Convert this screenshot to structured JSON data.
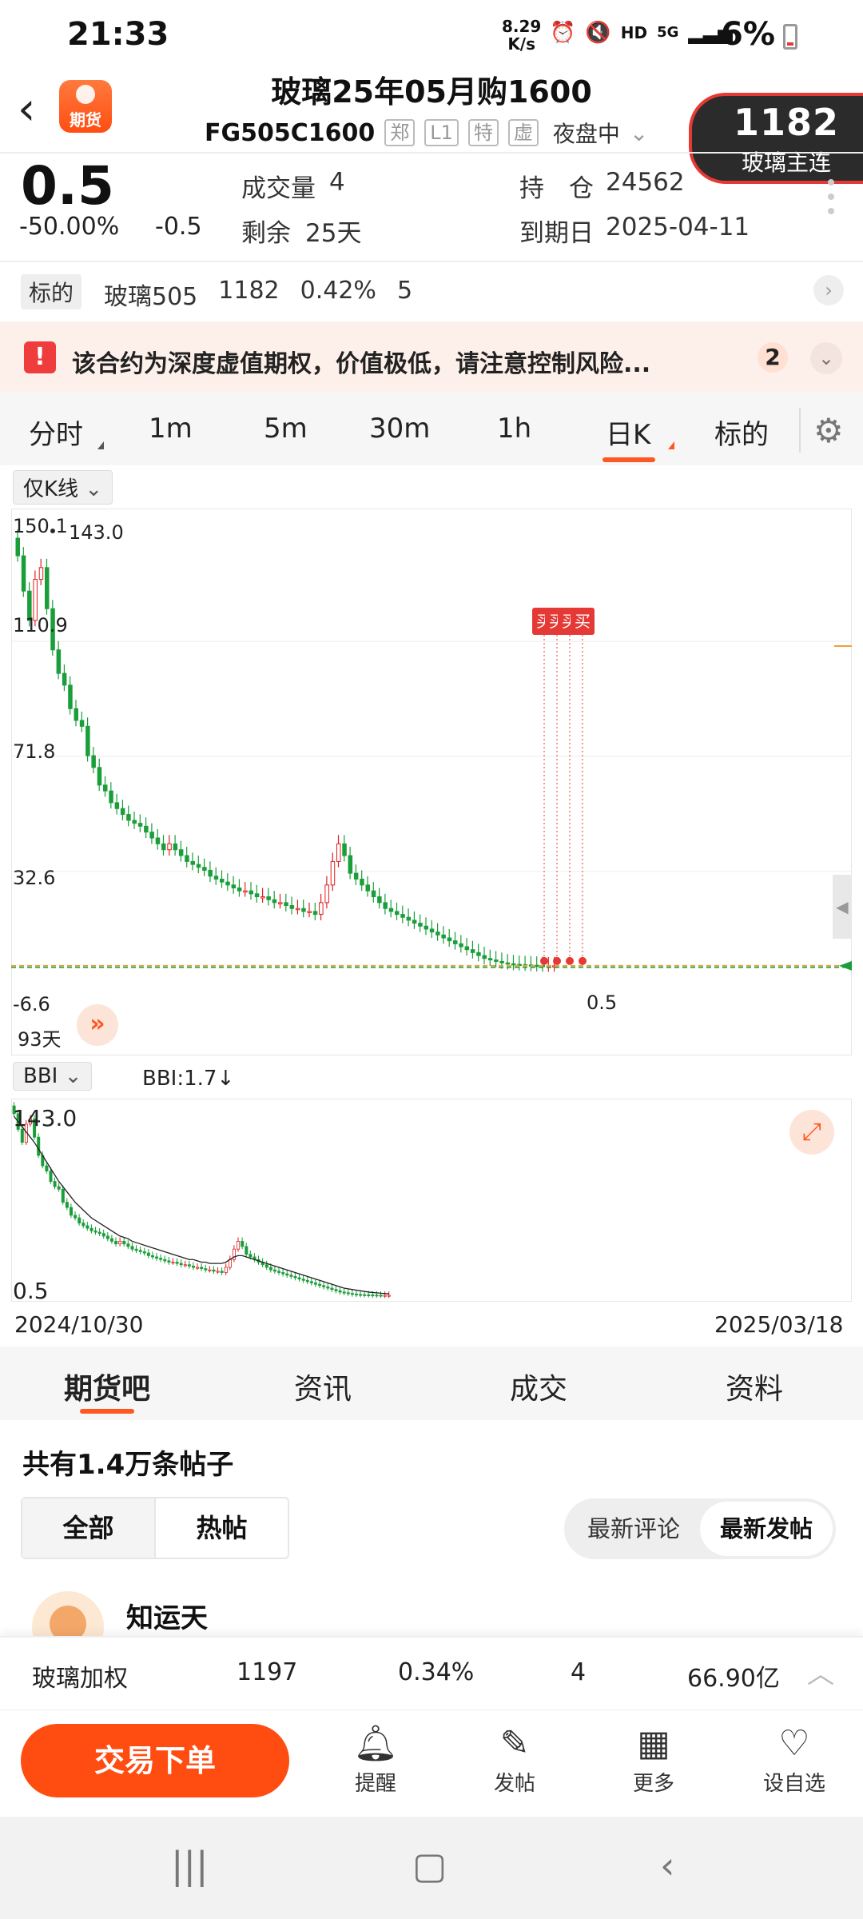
{
  "status_bar": {
    "time": "21:33",
    "net_speed_value": "8.29",
    "net_speed_unit": "K/s",
    "hd": "HD",
    "net_5g": "5G",
    "battery": "6%",
    "icons": [
      "alarm-icon",
      "mute-icon",
      "signal-icon",
      "battery-icon"
    ]
  },
  "header": {
    "logo_text": "期货",
    "title": "玻璃25年05月购1600",
    "code": "FG505C1600",
    "tags": [
      "郑",
      "L1",
      "特",
      "虚"
    ],
    "session": "夜盘中",
    "float_price": "1182",
    "float_name": "玻璃主连"
  },
  "quote": {
    "price": "0.5",
    "change_pct": "-50.00%",
    "change": "-0.5",
    "volume_label": "成交量",
    "volume": "4",
    "remaining_label": "剩余",
    "remaining": "25天",
    "oi_label": "持　仓",
    "oi": "24562",
    "expiry_label": "到期日",
    "expiry": "2025-04-11"
  },
  "underlying": {
    "label": "标的",
    "name": "玻璃505",
    "price": "1182",
    "pct": "0.42%",
    "change": "5"
  },
  "warning": {
    "icon": "!",
    "text": "该合约为深度虚值期权，价值极低，请注意控制风险...",
    "count": "2"
  },
  "period_tabs": [
    "分时",
    "1m",
    "5m",
    "30m",
    "1h",
    "日K",
    "标的"
  ],
  "active_period": "日K",
  "chart": {
    "mode_select": "仅K线",
    "axis_labels": [
      "150.1",
      "110.9",
      "71.8",
      "32.6",
      "-6.6"
    ],
    "max_marker": "143.0",
    "last_marker": "0.5",
    "days_label": "93天",
    "buy_label": "买",
    "indicator_select": "BBI",
    "indicator_value": "BBI:1.7↓",
    "sub_max": "143.0",
    "sub_min": "0.5",
    "start_date": "2024/10/30",
    "end_date": "2025/03/18"
  },
  "chart_data": {
    "type": "candlestick",
    "x_start": "2024/10/30",
    "x_end": "2025/03/18",
    "ylim": [
      -6.6,
      150.1
    ],
    "close": [
      140,
      128,
      118,
      132,
      136,
      122,
      108,
      100,
      96,
      88,
      84,
      82,
      72,
      68,
      62,
      60,
      56,
      54,
      52,
      50,
      49,
      48,
      46,
      44,
      42,
      40,
      42,
      40,
      38,
      36,
      35,
      34,
      33,
      31,
      30,
      29,
      28,
      27,
      26,
      26,
      25,
      24,
      24,
      23,
      22,
      22,
      21,
      20,
      20,
      19,
      19,
      18,
      22,
      28,
      36,
      42,
      38,
      32,
      30,
      28,
      26,
      24,
      22,
      20,
      19,
      18,
      17,
      16,
      15,
      14,
      13,
      12,
      11,
      10,
      9,
      8,
      7,
      6,
      5,
      4,
      3,
      2.5,
      2,
      1.5,
      1.2,
      1,
      0.9,
      0.8,
      0.7,
      0.6,
      0.5,
      0.5,
      0.5
    ],
    "bbi": [
      138,
      134,
      130,
      126,
      122,
      118,
      113,
      108,
      103,
      98,
      93,
      88,
      84,
      80,
      76,
      72,
      69,
      66,
      63,
      60,
      58,
      56,
      54,
      52,
      50,
      48,
      46,
      45,
      44,
      42,
      41,
      40,
      39,
      38,
      37,
      36,
      35,
      34,
      33,
      32,
      31,
      30,
      29,
      28,
      28,
      27,
      26,
      26,
      25,
      25,
      25,
      25,
      26,
      28,
      30,
      31,
      31,
      30,
      29,
      28,
      27,
      26,
      25,
      24,
      23,
      22,
      21,
      20,
      19,
      18,
      17,
      16,
      15,
      14,
      13,
      12,
      11,
      10,
      9,
      8,
      7,
      6,
      5.5,
      5,
      4.5,
      4,
      3.5,
      3,
      2.7,
      2.4,
      2.1,
      1.9,
      1.7
    ],
    "markers": [
      "买",
      "买",
      "买",
      "买"
    ]
  },
  "lower_tabs": [
    "期货吧",
    "资讯",
    "成交",
    "资料"
  ],
  "forum": {
    "post_count": "共有1.4万条帖子",
    "filter_all": "全部",
    "filter_hot": "热帖",
    "sort_comment": "最新评论",
    "sort_post": "最新发帖",
    "first_poster": "知运天"
  },
  "ticker": {
    "name": "玻璃加权",
    "price": "1197",
    "pct": "0.34%",
    "change": "4",
    "amount": "66.90亿"
  },
  "actions": {
    "trade": "交易下单",
    "remind": "提醒",
    "post": "发帖",
    "more": "更多",
    "watch": "设自选"
  }
}
